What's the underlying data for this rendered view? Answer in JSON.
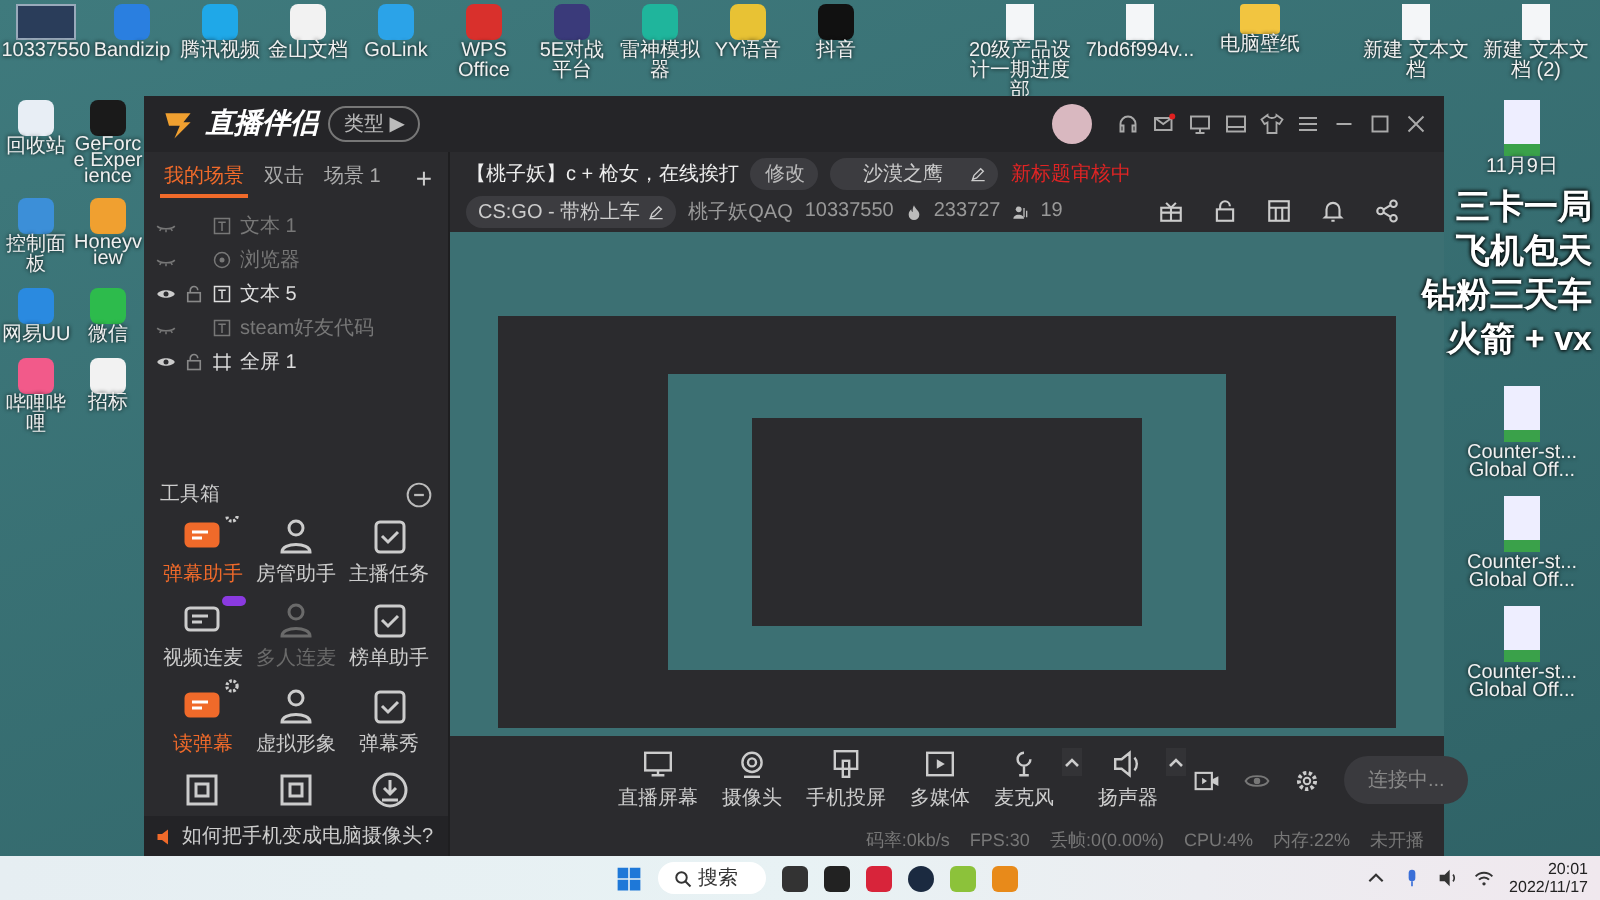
{
  "desktop": {
    "corner_icon": {
      "label": "10337550"
    },
    "top_icons": [
      {
        "label": "Bandizip"
      },
      {
        "label": "腾讯视频"
      },
      {
        "label": "金山文档"
      },
      {
        "label": "GoLink"
      },
      {
        "label": "WPS Office"
      },
      {
        "label": "5E对战平台"
      },
      {
        "label": "雷神模拟器"
      },
      {
        "label": "YY语音"
      },
      {
        "label": "抖音"
      }
    ],
    "top_files": [
      {
        "label": "20级产品设计一期进度部",
        "kind": "doc"
      },
      {
        "label": "7bd6f994v...",
        "kind": "doc"
      },
      {
        "label": "电脑壁纸",
        "kind": "folder"
      },
      {
        "label": "新建 文本文档",
        "kind": "doc"
      },
      {
        "label": "新建 文本文档 (2)",
        "kind": "doc"
      }
    ],
    "left_icons": [
      {
        "label": "回收站"
      },
      {
        "label": "GeForce Experience"
      },
      {
        "label": "控制面板"
      },
      {
        "label": "Honeyview"
      },
      {
        "label": "网易UU"
      },
      {
        "label": "微信"
      },
      {
        "label": "哔哩哔哩"
      },
      {
        "label": "招标"
      }
    ],
    "right_icons": [
      {
        "label": "11月9日"
      },
      {
        "label": "Counter-st... Global Off..."
      },
      {
        "label": "Counter-st... Global Off..."
      },
      {
        "label": "Counter-st... Global Off..."
      }
    ]
  },
  "app": {
    "logo": "直播伴侣",
    "type_button": "类型 ▶",
    "mail_unread": true,
    "tabs": [
      {
        "label": "我的场景",
        "selected": true
      },
      {
        "label": "双击",
        "selected": false
      },
      {
        "label": "场景 1",
        "selected": false
      }
    ],
    "add_tab": "+",
    "scenes": [
      {
        "name": "文本 1",
        "kind": "text",
        "visible": false
      },
      {
        "name": "浏览器",
        "kind": "browser",
        "visible": false
      },
      {
        "name": "文本 5",
        "kind": "text",
        "visible": true
      },
      {
        "name": "steam好友代码",
        "kind": "text",
        "visible": false
      },
      {
        "name": "全屏 1",
        "kind": "screen",
        "visible": true
      }
    ],
    "toolbox": {
      "title": "工具箱",
      "tools": [
        {
          "label": "弹幕助手",
          "active": true,
          "disabled": false,
          "settings": true,
          "new_badge": false
        },
        {
          "label": "房管助手",
          "active": false,
          "disabled": false,
          "settings": false,
          "new_badge": false
        },
        {
          "label": "主播任务",
          "active": false,
          "disabled": false,
          "settings": false,
          "new_badge": false
        },
        {
          "label": "视频连麦",
          "active": false,
          "disabled": false,
          "settings": false,
          "new_badge": true
        },
        {
          "label": "多人连麦",
          "active": false,
          "disabled": true,
          "settings": false,
          "new_badge": false
        },
        {
          "label": "榜单助手",
          "active": false,
          "disabled": false,
          "settings": false,
          "new_badge": false
        },
        {
          "label": "读弹幕",
          "active": true,
          "disabled": false,
          "settings": true,
          "new_badge": false
        },
        {
          "label": "虚拟形象",
          "active": false,
          "disabled": false,
          "settings": false,
          "new_badge": false
        },
        {
          "label": "弹幕秀",
          "active": false,
          "disabled": false,
          "settings": false,
          "new_badge": false
        }
      ]
    },
    "tip": "如何把手机变成电脑摄像头?",
    "stream": {
      "title": "【桃子妖】c + 枪女，在线挨打",
      "edit_button": "修改",
      "game": "沙漠之鹰",
      "review_status": "新标题审核中",
      "category": "CS:GO - 带粉上车",
      "streamer": "桃子妖QAQ",
      "room_id": "10337550",
      "popularity": "233727",
      "viewers": "19"
    },
    "overlay_lines": [
      "三卡一局",
      "飞机包天",
      "钻粉三天车",
      "火箭 + vx"
    ],
    "sources": [
      {
        "label": "直播屏幕",
        "has_menu": false
      },
      {
        "label": "摄像头",
        "has_menu": false
      },
      {
        "label": "手机投屏",
        "has_menu": false
      },
      {
        "label": "多媒体",
        "has_menu": false
      },
      {
        "label": "麦克风",
        "has_menu": true
      },
      {
        "label": "扬声器",
        "has_menu": true
      }
    ],
    "connect_button": "连接中...",
    "status": [
      "码率:0kb/s",
      "FPS:30",
      "丢帧:0(0.00%)",
      "CPU:4%",
      "内存:22%",
      "未开播"
    ]
  },
  "taskbar": {
    "search": "搜索",
    "time": "20:01",
    "date": "2022/11/17"
  }
}
